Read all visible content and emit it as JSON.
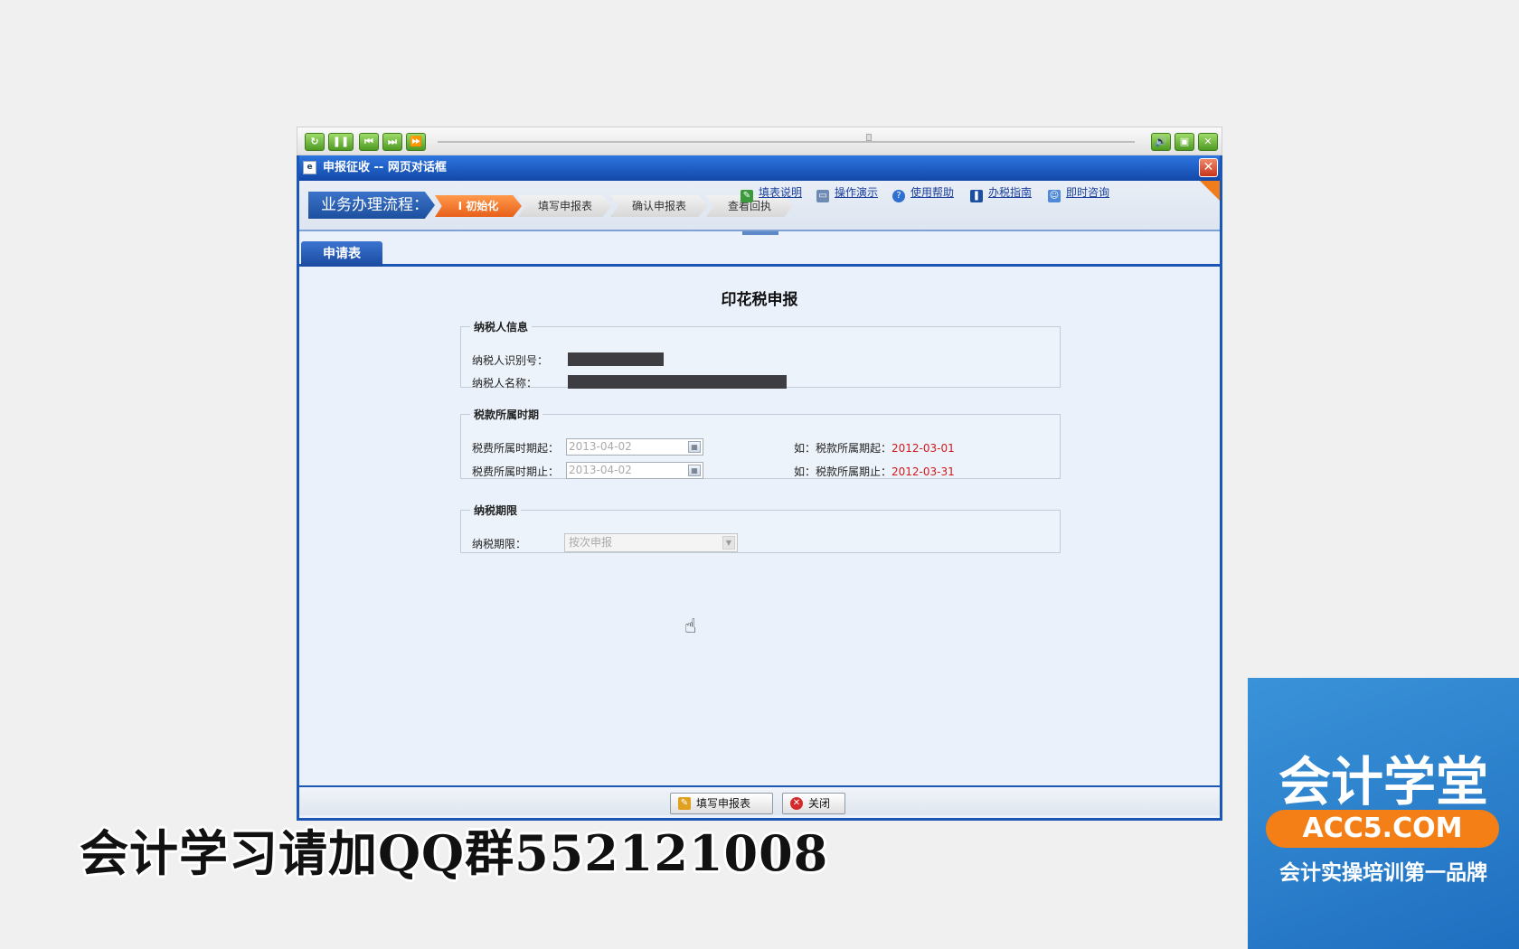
{
  "player": {
    "buttons": [
      "↻",
      "❚❚",
      "⏮",
      "⏭",
      "⏩"
    ],
    "right_buttons": [
      "🔊",
      "▣",
      "✕"
    ]
  },
  "dialog": {
    "title": "申报征收 -- 网页对话框",
    "close": "✕"
  },
  "flow": {
    "label": "业务办理流程：",
    "steps": [
      "I 初始化",
      "填写申报表",
      "确认申报表",
      "查看回执"
    ]
  },
  "links": {
    "fill_guide": "填表说明",
    "demo": "操作演示",
    "help": "使用帮助",
    "tax_guide": "办税指南",
    "consult": "即时咨询"
  },
  "tab": {
    "label": "申请表"
  },
  "form": {
    "title": "印花税申报",
    "taxpayer": {
      "legend": "纳税人信息",
      "id_label": "纳税人识别号：",
      "name_label": "纳税人名称："
    },
    "period": {
      "legend": "税款所属时期",
      "start_label": "税费所属时期起：",
      "start_value": "2013-04-02",
      "end_label": "税费所属时期止：",
      "end_value": "2013-04-02",
      "start_hint_prefix": "如：税款所属期起：",
      "start_hint_date": "2012-03-01",
      "end_hint_prefix": "如：税款所属期止：",
      "end_hint_date": "2012-03-31"
    },
    "deadline": {
      "legend": "纳税期限",
      "label": "纳税期限：",
      "selected": "按次申报"
    }
  },
  "footer": {
    "fill_button": "填写申报表",
    "close_button": "关闭"
  },
  "overlay": {
    "qq_text": "会计学习请加QQ群552121008",
    "logo_title": "会计学堂",
    "logo_domain": "ACC5.COM",
    "logo_slogan": "会计实操培训第一品牌"
  },
  "colors": {
    "accent_blue": "#1c57b5",
    "active_step": "#e8601b",
    "hint_red": "#d31818",
    "logo_orange": "#f47f16"
  }
}
